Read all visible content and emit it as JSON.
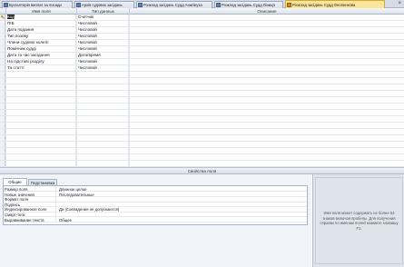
{
  "tabs": [
    {
      "label": "Бухгалтерія виплат за посади",
      "active": false
    },
    {
      "label": "Архів судових засідань",
      "active": false
    },
    {
      "label": "Розклад засідань Судд Анапікуза",
      "active": false
    },
    {
      "label": "Розклад засідань Судд Ліниця",
      "active": false
    },
    {
      "label": "Розклад засідань Судд Онопенкова",
      "active": true
    }
  ],
  "grid": {
    "headers": {
      "field_name": "Имя поля",
      "data_type": "Тип данных",
      "description": "Описание"
    },
    "rows": [
      {
        "name": "Код",
        "type": "Счетчик",
        "key": true
      },
      {
        "name": "ПІБ",
        "type": "Числовой"
      },
      {
        "name": "Дата подання",
        "type": "Числовой"
      },
      {
        "name": "Тип позову",
        "type": "Числовой"
      },
      {
        "name": "Члени судової колегії",
        "type": "Числовой"
      },
      {
        "name": "Помічник судді",
        "type": "Числовой"
      },
      {
        "name": "Дата та час засідання",
        "type": "Дата/время"
      },
      {
        "name": "На підставі розділу",
        "type": "Числовой"
      },
      {
        "name": "Та статті",
        "type": "Числовой"
      }
    ]
  },
  "properties": {
    "caption": "Свойства поля",
    "tab_general": "Общие",
    "tab_lookup": "Подстановка",
    "rows": [
      {
        "label": "Размер поля",
        "value": "Длинное целое"
      },
      {
        "label": "Новые значения",
        "value": "Последовательные"
      },
      {
        "label": "Формат поля",
        "value": ""
      },
      {
        "label": "Подпись",
        "value": ""
      },
      {
        "label": "Индексированное поле",
        "value": "Да (Совпадения не допускаются)"
      },
      {
        "label": "Смарт-теги",
        "value": ""
      },
      {
        "label": "Выравнивание текста",
        "value": "Общее"
      }
    ]
  },
  "hint": "Имя поля может содержать не более 64 знаков включая пробелы. Для получения справки по именам полей нажмите клавишу F1."
}
